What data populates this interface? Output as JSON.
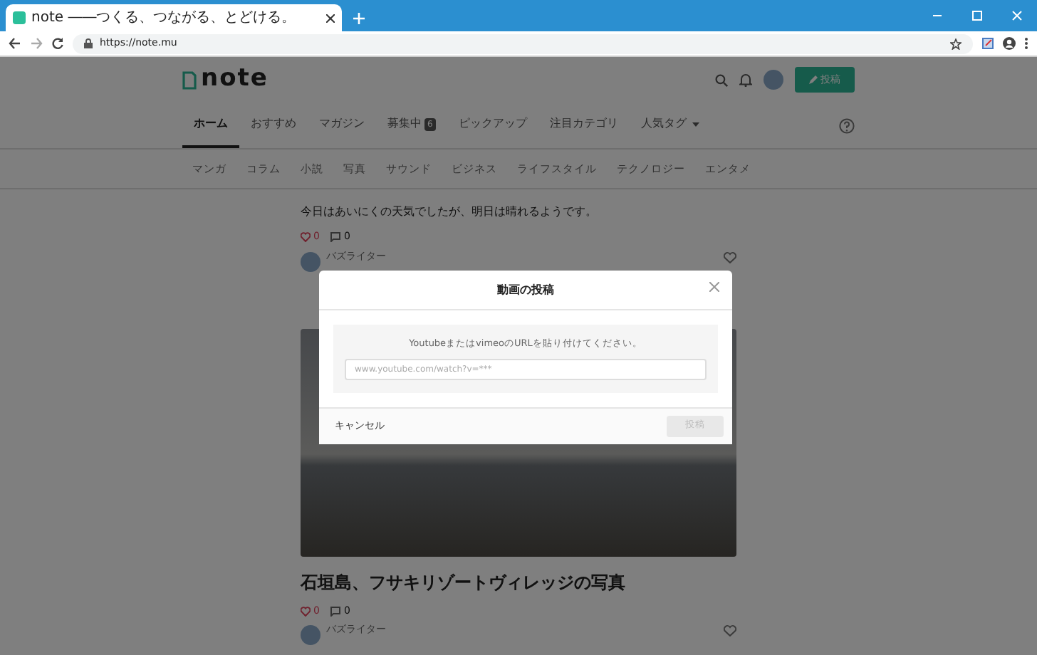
{
  "browser": {
    "tab_title": "note ――つくる、つながる、とどける。",
    "url": "https://note.mu"
  },
  "header": {
    "logo": "note",
    "post_button": "投稿"
  },
  "nav_tabs": [
    {
      "label": "ホーム",
      "selected": true
    },
    {
      "label": "おすすめ",
      "selected": false
    },
    {
      "label": "マガジン",
      "selected": false
    },
    {
      "label": "募集中",
      "badge": "6",
      "selected": false
    },
    {
      "label": "ピックアップ",
      "selected": false
    },
    {
      "label": "注目カテゴリ",
      "selected": false
    },
    {
      "label": "人気タグ",
      "dropdown": true,
      "selected": false
    }
  ],
  "categories": [
    "マンガ",
    "コラム",
    "小説",
    "写真",
    "サウンド",
    "ビジネス",
    "ライフスタイル",
    "テクノロジー",
    "エンタメ"
  ],
  "feed": [
    {
      "kind": "text",
      "body": "今日はあいにくの天気でしたが、明日は晴れるようです。",
      "likes": "0",
      "comments": "0",
      "author": "バズライター"
    },
    {
      "kind": "photo",
      "title": "石垣島、フサキリゾートヴィレッジの写真",
      "likes": "0",
      "comments": "0",
      "author": "バズライター"
    }
  ],
  "modal": {
    "title": "動画の投稿",
    "instruction": "YoutubeまたはvimeoのURLを貼り付けてください。",
    "url_field": {
      "placeholder": "www.youtube.com/watch?v=***"
    },
    "cancel": "キャンセル",
    "submit": {
      "label": "投稿",
      "disabled": true
    }
  }
}
